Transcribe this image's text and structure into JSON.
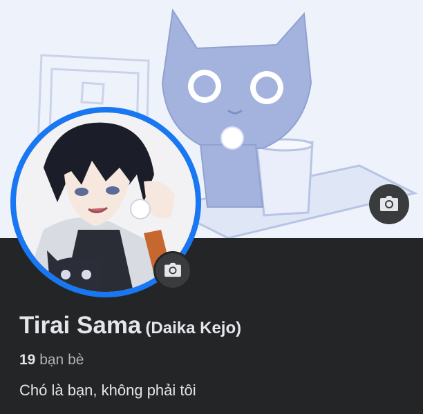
{
  "profile": {
    "name": "Tirai Sama",
    "alternate_name": "(Daika Kejo)",
    "friends_count": "19",
    "friends_label": "bạn bè",
    "bio": "Chó là bạn, không phải tôi"
  },
  "icons": {
    "cover_camera": "camera-icon",
    "avatar_camera": "camera-icon"
  },
  "colors": {
    "background": "#242526",
    "avatar_ring": "#1877f2",
    "text_primary": "#e4e6eb",
    "text_secondary": "#b0b3b8",
    "button": "#3a3b3c"
  }
}
